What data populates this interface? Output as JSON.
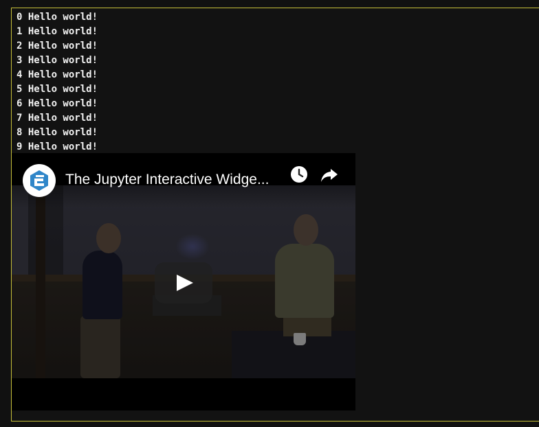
{
  "output": {
    "lines": [
      "0 Hello world!",
      "1 Hello world!",
      "2 Hello world!",
      "3 Hello world!",
      "4 Hello world!",
      "5 Hello world!",
      "6 Hello world!",
      "7 Hello world!",
      "8 Hello world!",
      "9 Hello world!"
    ]
  },
  "video": {
    "title": "The Jupyter Interactive Widge...",
    "channel_logo_icon": "enthought-logo-icon",
    "watch_later_icon": "clock-icon",
    "share_icon": "share-arrow-icon",
    "play_icon": "play-icon"
  },
  "colors": {
    "cell_border": "#c9c23a",
    "background": "#111111",
    "logo_blue": "#2f86c9"
  }
}
